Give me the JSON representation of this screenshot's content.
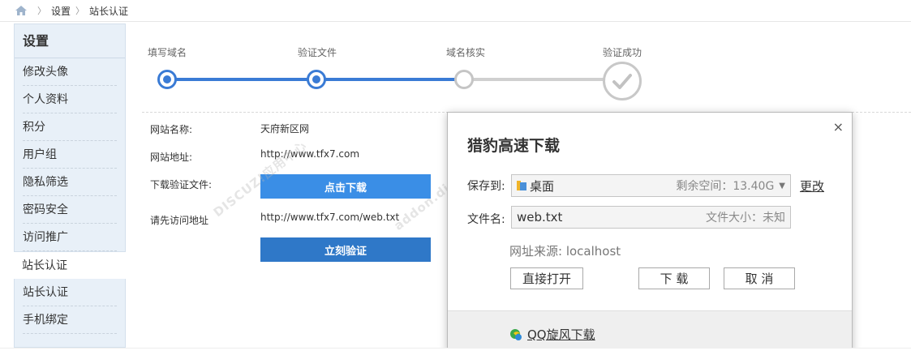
{
  "breadcrumb": {
    "items": [
      "设置",
      "站长认证"
    ]
  },
  "sidebar": {
    "title": "设置",
    "items": [
      {
        "label": "修改头像"
      },
      {
        "label": "个人资料"
      },
      {
        "label": "积分"
      },
      {
        "label": "用户组"
      },
      {
        "label": "隐私筛选"
      },
      {
        "label": "密码安全"
      },
      {
        "label": "访问推广"
      },
      {
        "label": "站长认证",
        "active": true
      },
      {
        "label": "站长认证"
      },
      {
        "label": "手机绑定"
      }
    ]
  },
  "steps": {
    "items": [
      {
        "label": "填写域名",
        "state": "done"
      },
      {
        "label": "验证文件",
        "state": "current"
      },
      {
        "label": "域名核实",
        "state": "pending"
      },
      {
        "label": "验证成功",
        "state": "pending"
      }
    ],
    "accent": "#3a7bd5"
  },
  "form": {
    "site_name_label": "网站名称:",
    "site_name_value": "天府新区网",
    "site_url_label": "网站地址:",
    "site_url_value": "http://www.tfx7.com",
    "download_label": "下载验证文件:",
    "download_button": "点击下载",
    "visit_label": "请先访问地址",
    "visit_url": "http://www.tfx7.com/web.txt",
    "verify_button": "立刻验证"
  },
  "watermark": {
    "text": "DISCUZ!应用中心",
    "sub": "addon.discuz.com"
  },
  "dialog": {
    "title": "猎豹高速下载",
    "close": "×",
    "save_to_label": "保存到:",
    "save_to_value": "桌面",
    "free_space": "剩余空间：13.40G",
    "change": "更改",
    "filename_label": "文件名:",
    "filename_value": "web.txt",
    "file_size": "文件大小：未知",
    "source": "网址来源: localhost",
    "open_button": "直接打开",
    "download_button": "下 载",
    "cancel_button": "取 消",
    "qq_link": "QQ旋风下载"
  }
}
